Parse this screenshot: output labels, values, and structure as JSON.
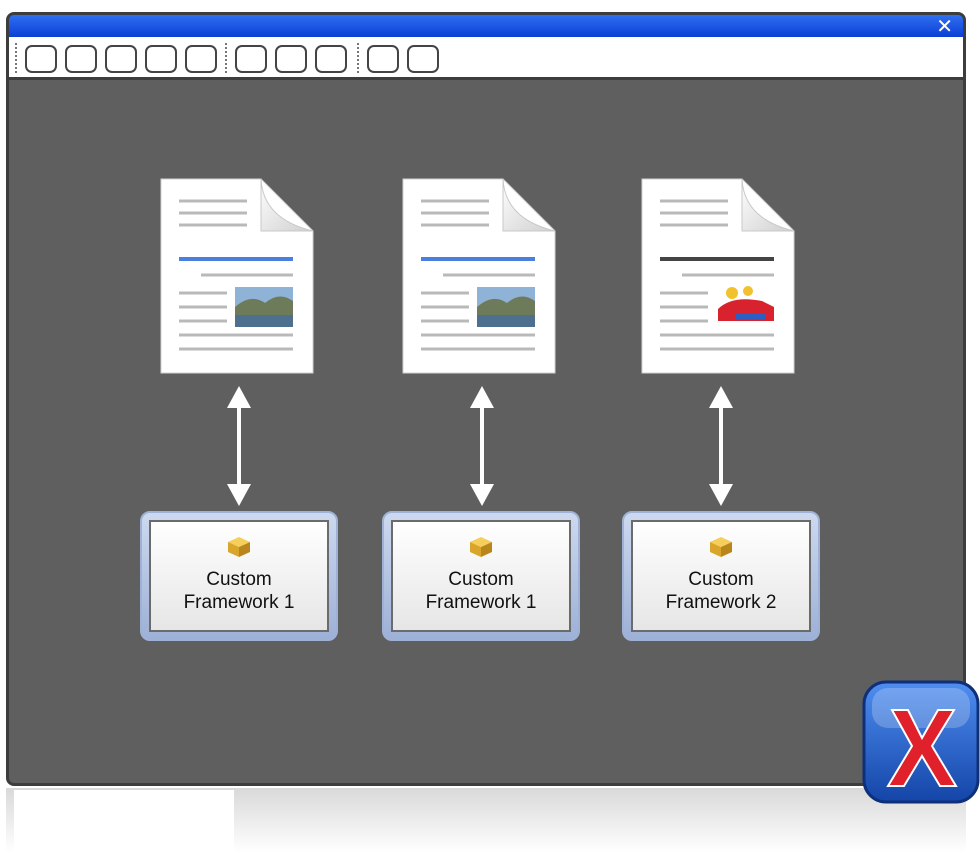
{
  "window": {
    "close_glyph": "✕",
    "toolbar_buttons": [
      {
        "icon": "toolbar-button-icon"
      },
      {
        "icon": "toolbar-button-icon"
      },
      {
        "icon": "toolbar-button-icon"
      },
      {
        "icon": "toolbar-button-icon"
      },
      {
        "icon": "toolbar-button-icon"
      },
      {
        "icon": "toolbar-button-icon"
      },
      {
        "icon": "toolbar-button-icon"
      },
      {
        "icon": "toolbar-button-icon"
      },
      {
        "icon": "toolbar-button-icon"
      },
      {
        "icon": "toolbar-button-icon"
      }
    ]
  },
  "documents": [
    {
      "icon": "document-icon",
      "thumbnail": "landscape-photo-icon",
      "heading_color": "#4a7fe0"
    },
    {
      "icon": "document-icon",
      "thumbnail": "landscape-photo-icon",
      "heading_color": "#4a7fe0"
    },
    {
      "icon": "document-icon",
      "thumbnail": "clipart-car-icon",
      "heading_color": "#444444"
    }
  ],
  "frameworks": [
    {
      "line1": "Custom",
      "line2": "Framework 1",
      "icon": "package-icon"
    },
    {
      "line1": "Custom",
      "line2": "Framework 1",
      "icon": "package-icon"
    },
    {
      "line1": "Custom",
      "line2": "Framework 2",
      "icon": "package-icon"
    }
  ],
  "colors": {
    "titlebar": "#0b3fd6",
    "canvas": "#5f5f5f",
    "framework_border": "#9fb2d6",
    "logo_blue": "#1f5fc8",
    "logo_red": "#e0202a"
  },
  "logo": {
    "icon": "oxygen-xml-logo-icon"
  }
}
